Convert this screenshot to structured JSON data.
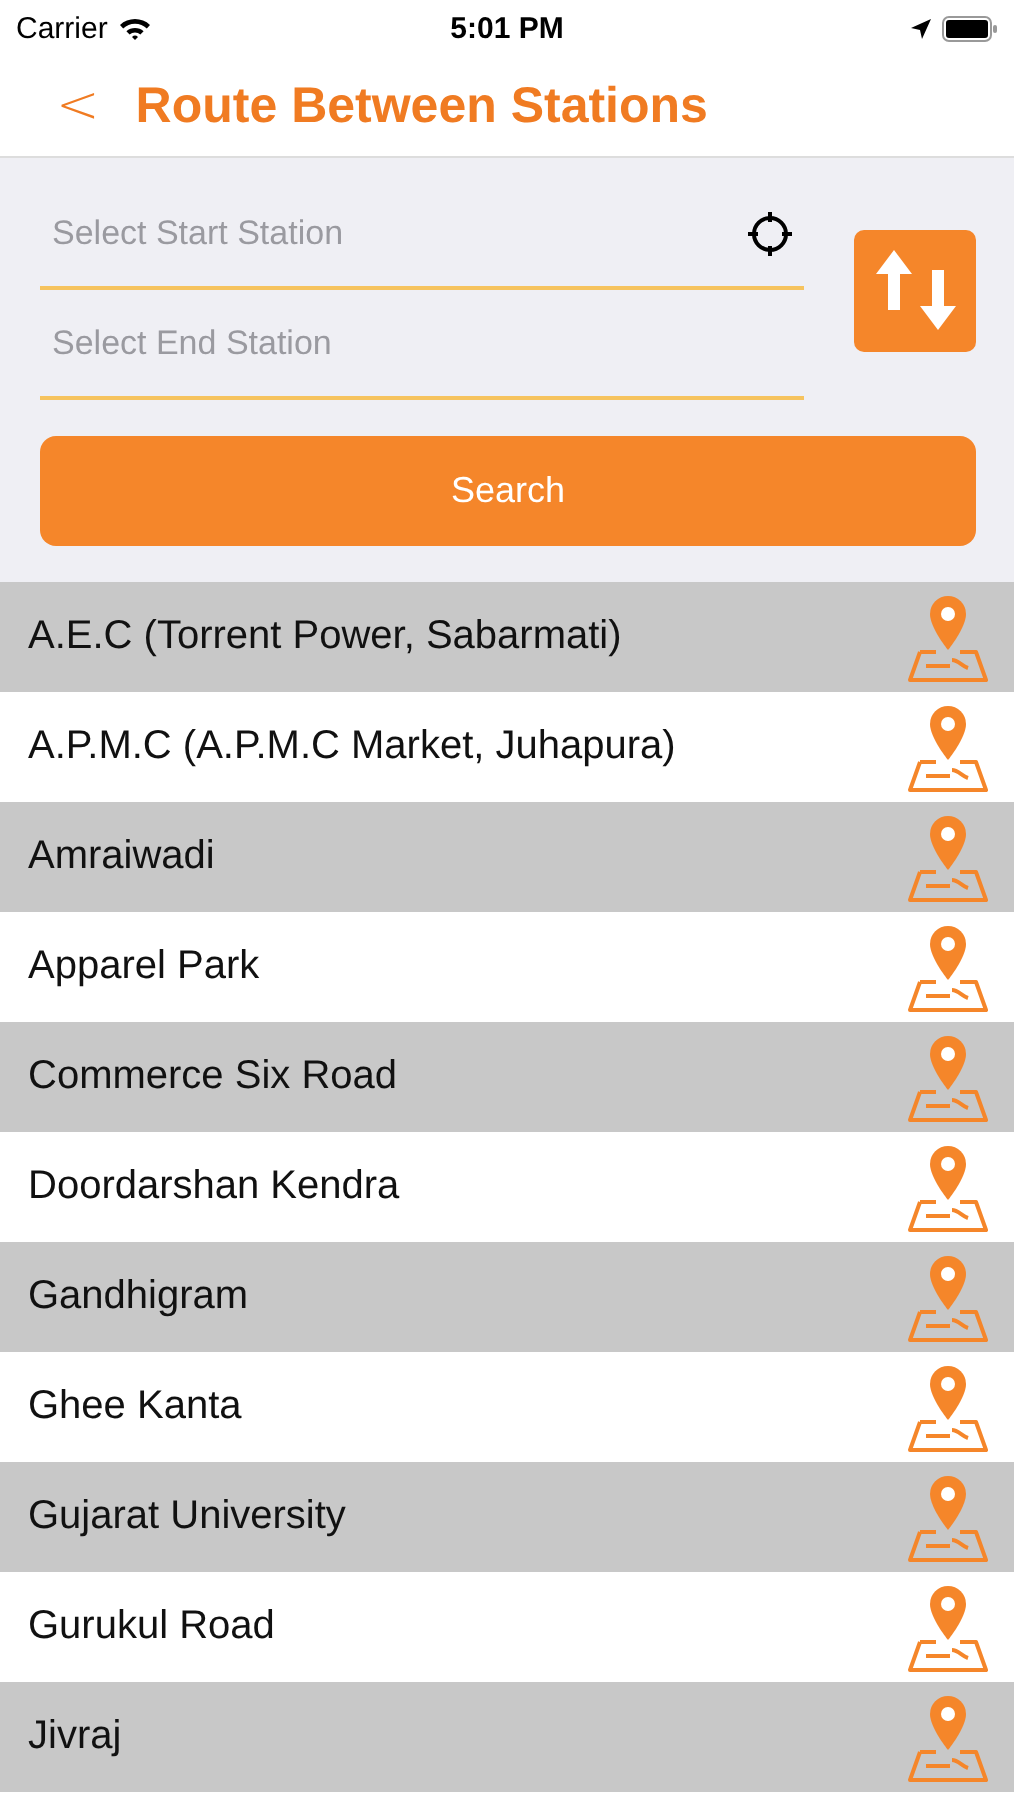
{
  "status_bar": {
    "carrier": "Carrier",
    "time": "5:01 PM"
  },
  "nav": {
    "back": "<",
    "title": "Route Between Stations"
  },
  "form": {
    "start": {
      "placeholder": "Select Start Station"
    },
    "end": {
      "placeholder": "Select End Station"
    },
    "search_button": "Search"
  },
  "stations": [
    {
      "name": "A.E.C (Torrent Power, Sabarmati)"
    },
    {
      "name": "A.P.M.C (A.P.M.C Market, Juhapura)"
    },
    {
      "name": "Amraiwadi"
    },
    {
      "name": "Apparel Park"
    },
    {
      "name": "Commerce Six Road"
    },
    {
      "name": "Doordarshan Kendra"
    },
    {
      "name": "Gandhigram"
    },
    {
      "name": "Ghee Kanta"
    },
    {
      "name": "Gujarat University"
    },
    {
      "name": "Gurukul Road"
    },
    {
      "name": "Jivraj"
    }
  ]
}
